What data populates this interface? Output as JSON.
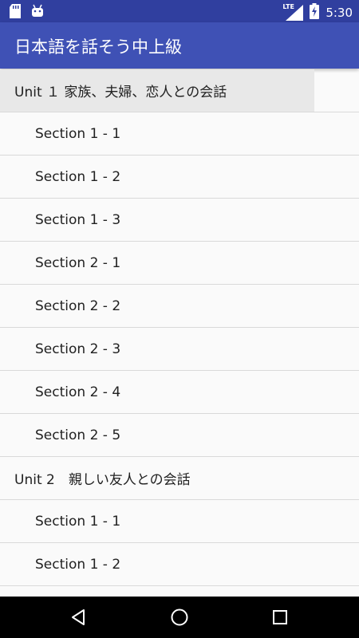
{
  "status_bar": {
    "network": "LTE",
    "time": "5:30",
    "icons": [
      "sd-card-icon",
      "android-icon",
      "signal-icon",
      "battery-charging-icon"
    ]
  },
  "app_bar": {
    "title": "日本語を話そう中上級"
  },
  "list": [
    {
      "type": "unit",
      "label": "Unit １ 家族、夫婦、恋人との会話",
      "selected": true
    },
    {
      "type": "section",
      "label": "Section 1 - 1"
    },
    {
      "type": "section",
      "label": "Section 1 - 2"
    },
    {
      "type": "section",
      "label": "Section 1 - 3"
    },
    {
      "type": "section",
      "label": "Section 2 - 1"
    },
    {
      "type": "section",
      "label": "Section 2 - 2"
    },
    {
      "type": "section",
      "label": "Section 2 - 3"
    },
    {
      "type": "section",
      "label": "Section 2 - 4"
    },
    {
      "type": "section",
      "label": "Section 2 - 5"
    },
    {
      "type": "unit",
      "label": "Unit 2　親しい友人との会話",
      "selected": false
    },
    {
      "type": "section",
      "label": "Section 1 - 1"
    },
    {
      "type": "section",
      "label": "Section 1 - 2"
    },
    {
      "type": "section",
      "label": ""
    }
  ],
  "nav_bar": {
    "icons": [
      "back-icon",
      "home-icon",
      "recents-icon"
    ]
  },
  "colors": {
    "status_bar": "#303f9f",
    "app_bar": "#3f51b5",
    "background": "#fafafa",
    "selected_row": "#e8e8e8"
  }
}
